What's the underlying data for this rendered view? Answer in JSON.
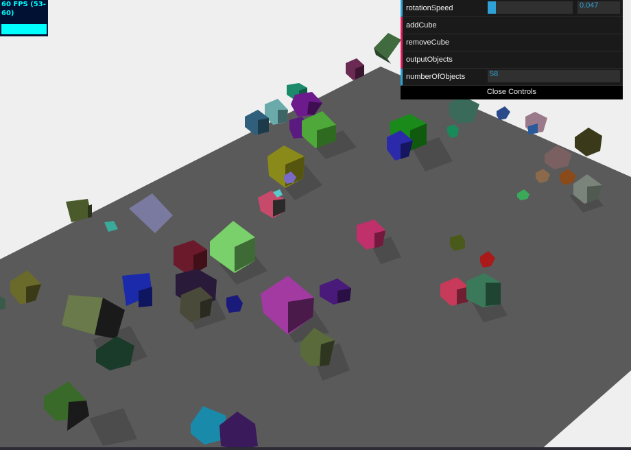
{
  "stats": {
    "fps_text": "60 FPS (53-60)"
  },
  "gui": {
    "rotationSpeed": {
      "label": "rotationSpeed",
      "value": "0.047",
      "fraction": 0.094
    },
    "addCube": {
      "label": "addCube"
    },
    "removeCube": {
      "label": "removeCube"
    },
    "outputObjects": {
      "label": "outputObjects"
    },
    "numberOfObjects": {
      "label": "numberOfObjects",
      "value": "58"
    },
    "close_label": "Close Controls"
  },
  "colors": {
    "background": "#efefef",
    "plane": "#5a5a5a",
    "accent": "#2fa1d6",
    "function_accent": "#e61d5f"
  }
}
